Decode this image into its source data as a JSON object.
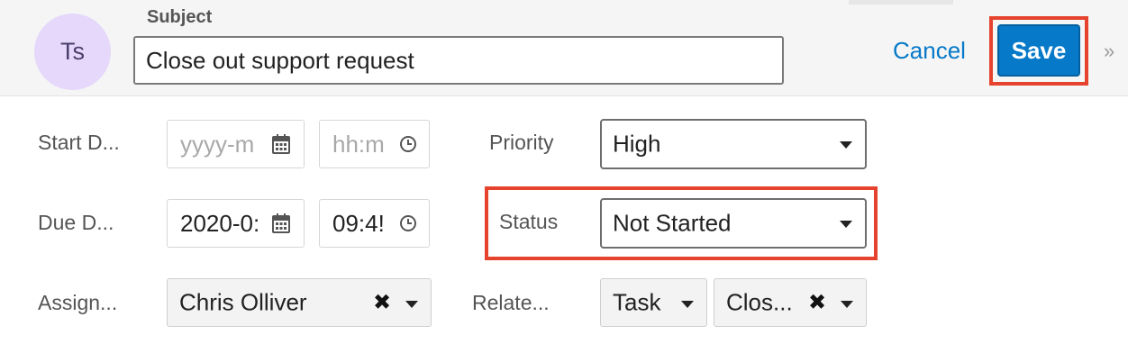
{
  "header": {
    "avatar_initials": "Ts",
    "subject_label": "Subject",
    "subject_value": "Close out support request",
    "cancel_label": "Cancel",
    "save_label": "Save",
    "collapse_glyph": "»"
  },
  "fields": {
    "start_date": {
      "label": "Start D...",
      "date_placeholder": "yyyy-m",
      "time_placeholder": "hh:m"
    },
    "due_date": {
      "label": "Due D...",
      "date_value": "2020-0:",
      "time_value": "09:4!"
    },
    "priority": {
      "label": "Priority",
      "value": "High"
    },
    "status": {
      "label": "Status",
      "value": "Not Started"
    },
    "assigned": {
      "label": "Assign...",
      "value": "Chris Olliver",
      "clear_glyph": "✖"
    },
    "related": {
      "label": "Relate...",
      "type_value": "Task",
      "record_value": "Clos...",
      "clear_glyph": "✖"
    }
  },
  "colors": {
    "accent": "#0679c8",
    "highlight": "#e5432d",
    "avatar_bg": "#e5d8fb"
  },
  "icons": [
    "calendar-icon",
    "clock-icon",
    "caret-down-icon",
    "clear-icon",
    "double-chevron-right-icon"
  ]
}
